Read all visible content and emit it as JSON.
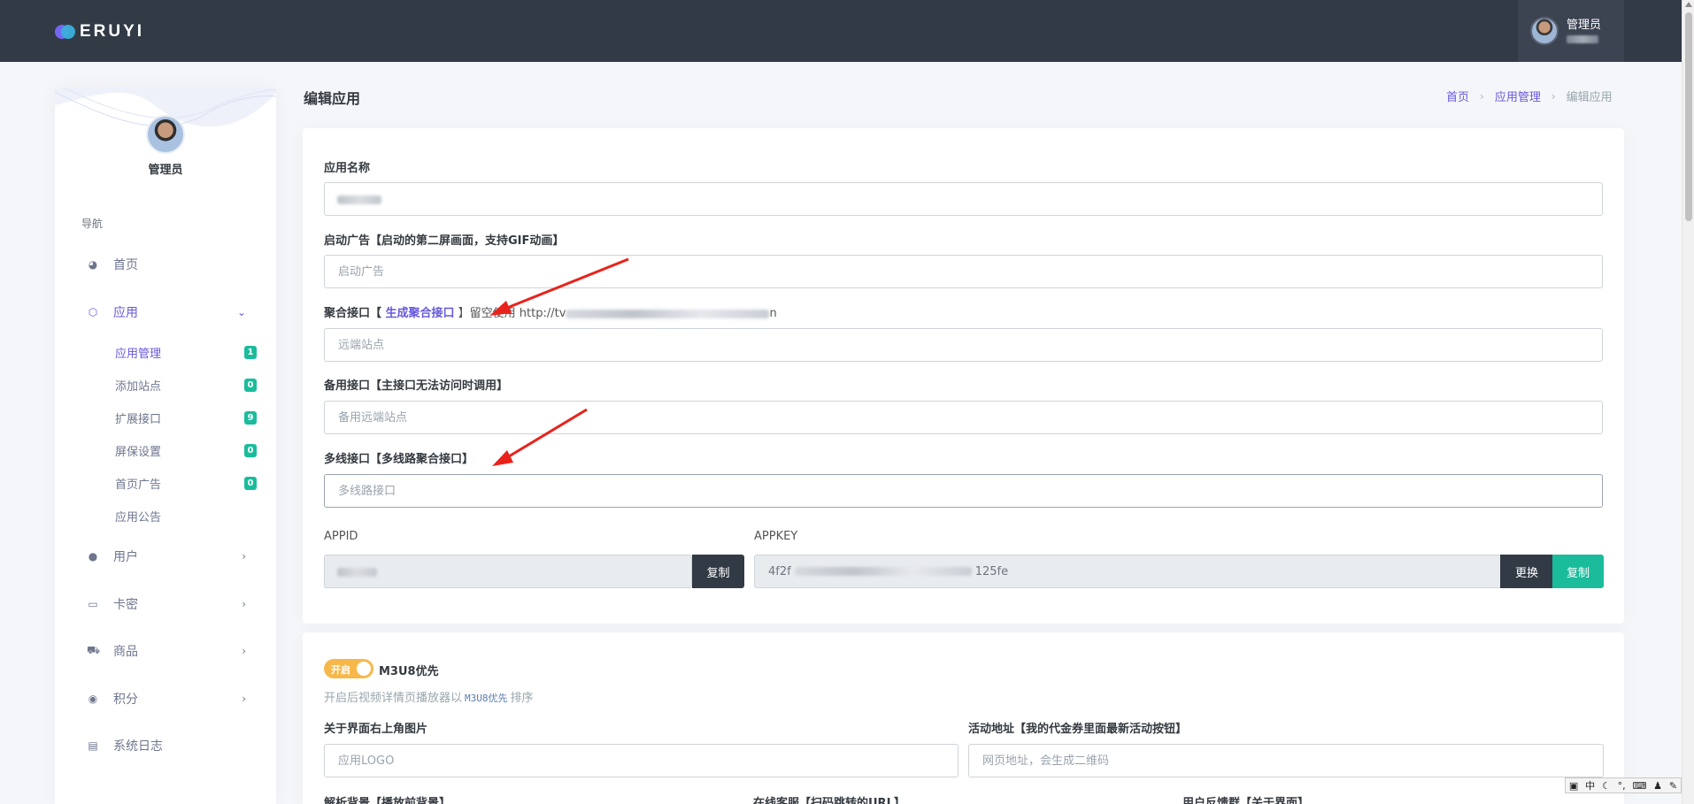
{
  "brand": {
    "logo_text": "ERUYI"
  },
  "topbar": {
    "user_name": "管理员"
  },
  "sidebar": {
    "user_name": "管理员",
    "nav_title": "导航",
    "items": [
      {
        "label": "首页",
        "icon": "dashboard-icon"
      },
      {
        "label": "应用",
        "icon": "cube-icon",
        "expanded": true
      },
      {
        "label": "用户",
        "icon": "user-icon"
      },
      {
        "label": "卡密",
        "icon": "card-icon"
      },
      {
        "label": "商品",
        "icon": "cart-icon"
      },
      {
        "label": "积分",
        "icon": "coin-icon"
      },
      {
        "label": "系统日志",
        "icon": "log-icon"
      }
    ],
    "sub_items": [
      {
        "label": "应用管理",
        "badge": "1"
      },
      {
        "label": "添加站点",
        "badge": "0"
      },
      {
        "label": "扩展接口",
        "badge": "9"
      },
      {
        "label": "屏保设置",
        "badge": "0"
      },
      {
        "label": "首页广告",
        "badge": "0"
      },
      {
        "label": "应用公告"
      }
    ]
  },
  "page": {
    "title": "编辑应用",
    "breadcrumb": [
      "首页",
      "应用管理",
      "编辑应用"
    ]
  },
  "form": {
    "app_name": {
      "label": "应用名称"
    },
    "launch_ad": {
      "label": "启动广告【启动的第二屏画面，支持GIF动画】",
      "placeholder": "启动广告"
    },
    "aggregate": {
      "label_prefix": "聚合接口【 ",
      "link": "生成聚合接口",
      "label_suffix": " 】留空使用 http://tv",
      "url_tail": "n",
      "placeholder": "远端站点"
    },
    "backup": {
      "label": "备用接口【主接口无法访问时调用】",
      "placeholder": "备用远端站点"
    },
    "multiline": {
      "label": "多线接口【多线路聚合接口】",
      "placeholder": "多线路接口"
    },
    "appid": {
      "label": "APPID",
      "copy": "复制"
    },
    "appkey": {
      "label": "APPKEY",
      "value_head": "4f2f",
      "value_tail": "125fe",
      "change": "更换",
      "copy": "复制"
    }
  },
  "card2": {
    "toggle_label": "开启",
    "toggle_title": "M3U8优先",
    "help_prefix": "开启后视频详情页播放器以",
    "help_code": "M3U8优先",
    "help_suffix": "排序",
    "about_image": {
      "label": "关于界面右上角图片",
      "placeholder": "应用LOGO"
    },
    "activity": {
      "label": "活动地址【我的代金券里面最新活动按钮】",
      "placeholder": "网页地址，会生成二维码"
    },
    "bottom_labels": [
      "解析背景【播放前背景】",
      "在线客服【扫码跳转的URL】",
      "用户反馈群【关于界面】"
    ]
  },
  "ime": {
    "text": "中"
  },
  "colors": {
    "topbar": "#323a46",
    "accent": "#6658dd",
    "success": "#1abc9c",
    "warning": "#f7b84b",
    "arrow": "#e8231c"
  }
}
